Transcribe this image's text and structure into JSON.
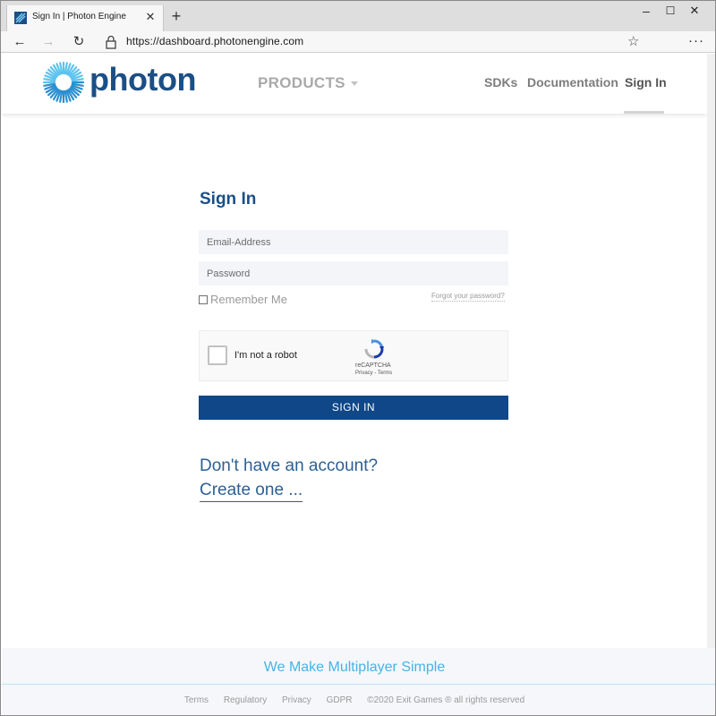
{
  "browser": {
    "tab_title": "Sign In | Photon Engine",
    "tab_close": "✕",
    "new_tab": "+",
    "url": "https://dashboard.photonengine.com",
    "window_controls": {
      "minimize": "–",
      "maximize": "☐",
      "close": "✕"
    },
    "nav": {
      "back": "←",
      "forward": "→",
      "refresh": "↻"
    },
    "star": "☆",
    "more": "···"
  },
  "header": {
    "logo_text": "photon",
    "products": "PRODUCTS",
    "sdks": "SDKs",
    "documentation": "Documentation",
    "sign_in": "Sign In"
  },
  "form": {
    "title": "Sign In",
    "email_placeholder": "Email-Address",
    "password_placeholder": "Password",
    "remember_me": "Remember Me",
    "forgot_password": "Forgot your password?",
    "captcha_label": "I'm not a robot",
    "captcha_brand": "reCAPTCHA",
    "captcha_links": "Privacy - Terms",
    "submit": "SIGN IN"
  },
  "signup": {
    "prompt": "Don't have an account?",
    "link": "Create one ..."
  },
  "footer": {
    "tagline": "We Make Multiplayer Simple",
    "links": [
      "Terms",
      "Regulatory",
      "Privacy",
      "GDPR"
    ],
    "copyright": "©2020 Exit Games ® all rights reserved"
  },
  "colors": {
    "brand_blue": "#1b4f86",
    "button_blue": "#0f4788",
    "tagline_blue": "#45b4e8"
  },
  "icons": {
    "favicon": "photon-favicon-icon",
    "lock": "lock-icon",
    "logo": "photon-sunburst-icon",
    "captcha": "recaptcha-icon"
  }
}
